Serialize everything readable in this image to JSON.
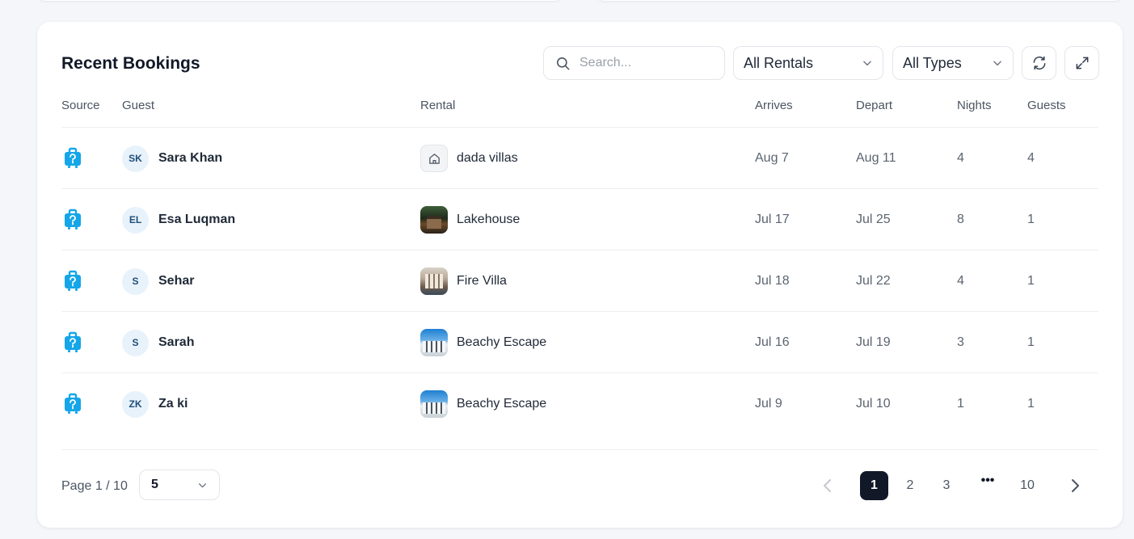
{
  "header": {
    "title": "Recent Bookings",
    "search_placeholder": "Search...",
    "rental_filter": "All Rentals",
    "type_filter": "All Types"
  },
  "columns": [
    "Source",
    "Guest",
    "Rental",
    "Arrives",
    "Depart",
    "Nights",
    "Guests"
  ],
  "rows": [
    {
      "initials": "SK",
      "guest": "Sara Khan",
      "rental": "dada villas",
      "thumb": "placeholder",
      "arrives": "Aug 7",
      "depart": "Aug 11",
      "nights": "4",
      "guests": "4"
    },
    {
      "initials": "EL",
      "guest": "Esa Luqman",
      "rental": "Lakehouse",
      "thumb": "lake",
      "arrives": "Jul 17",
      "depart": "Jul 25",
      "nights": "8",
      "guests": "1"
    },
    {
      "initials": "S",
      "guest": "Sehar",
      "rental": "Fire Villa",
      "thumb": "fire",
      "arrives": "Jul 18",
      "depart": "Jul 22",
      "nights": "4",
      "guests": "1"
    },
    {
      "initials": "S",
      "guest": "Sarah",
      "rental": "Beachy Escape",
      "thumb": "beach",
      "arrives": "Jul 16",
      "depart": "Jul 19",
      "nights": "3",
      "guests": "1"
    },
    {
      "initials": "ZK",
      "guest": "Za ki",
      "rental": "Beachy Escape",
      "thumb": "beach",
      "arrives": "Jul 9",
      "depart": "Jul 10",
      "nights": "1",
      "guests": "1"
    }
  ],
  "pagination": {
    "label": "Page 1 / 10",
    "page_size": "5",
    "pages": [
      "1",
      "2",
      "3",
      "•••",
      "10"
    ],
    "current": "1"
  },
  "icons": {
    "source": "travel-bag-icon",
    "search": "search-icon",
    "refresh": "refresh-icon",
    "expand": "expand-icon",
    "chevron": "chevron-down-icon",
    "prev": "chevron-left-icon",
    "next": "chevron-right-icon",
    "home": "home-icon"
  },
  "colors": {
    "source_icon": "#14a6e8",
    "active_page": "#111827",
    "avatar_bg": "#e8f2fb"
  }
}
